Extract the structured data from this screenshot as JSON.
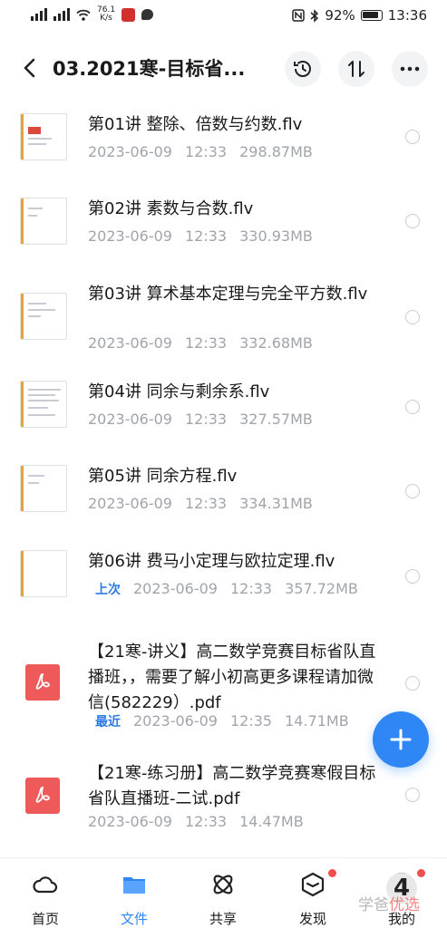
{
  "status_bar": {
    "speed": "76.1",
    "speed_unit": "K/s",
    "battery": "92%",
    "time": "13:36"
  },
  "header": {
    "title": "03.2021寒-目标省..."
  },
  "files": [
    {
      "name": "第01讲 整除、倍数与约数.flv",
      "date": "2023-06-09",
      "time": "12:33",
      "size": "298.87MB",
      "tag": ""
    },
    {
      "name": "第02讲 素数与合数.flv",
      "date": "2023-06-09",
      "time": "12:33",
      "size": "330.93MB",
      "tag": ""
    },
    {
      "name": "第03讲 算术基本定理与完全平方数.flv",
      "date": "2023-06-09",
      "time": "12:33",
      "size": "332.68MB",
      "tag": ""
    },
    {
      "name": "第04讲 同余与剩余系.flv",
      "date": "2023-06-09",
      "time": "12:33",
      "size": "327.57MB",
      "tag": ""
    },
    {
      "name": "第05讲 同余方程.flv",
      "date": "2023-06-09",
      "time": "12:33",
      "size": "334.31MB",
      "tag": ""
    },
    {
      "name": "第06讲 费马小定理与欧拉定理.flv",
      "date": "2023-06-09",
      "time": "12:33",
      "size": "357.72MB",
      "tag": "上次"
    },
    {
      "name": "【21寒-讲义】高二数学竞赛目标省队直播班，，需要了解小初高更多课程请加微信(582229）.pdf",
      "date": "2023-06-09",
      "time": "12:35",
      "size": "14.71MB",
      "tag": "最近"
    },
    {
      "name": "【21寒-练习册】高二数学竞赛寒假目标省队直播班-二试.pdf",
      "date": "2023-06-09",
      "time": "12:33",
      "size": "14.47MB",
      "tag": ""
    }
  ],
  "tabs": [
    {
      "label": "首页",
      "icon": "cloud-icon"
    },
    {
      "label": "文件",
      "icon": "folder-icon"
    },
    {
      "label": "共享",
      "icon": "share-icon"
    },
    {
      "label": "发现",
      "icon": "cube-icon"
    },
    {
      "label": "我的",
      "icon": "profile-icon"
    }
  ],
  "overlay": {
    "watermark_a": "学爸",
    "watermark_b": "优选",
    "badge_number": "4"
  },
  "colors": {
    "accent": "#2f87f5",
    "tag": "#2c7be5",
    "pdf": "#ee5a5a",
    "notification_dot": "#f0514e"
  }
}
